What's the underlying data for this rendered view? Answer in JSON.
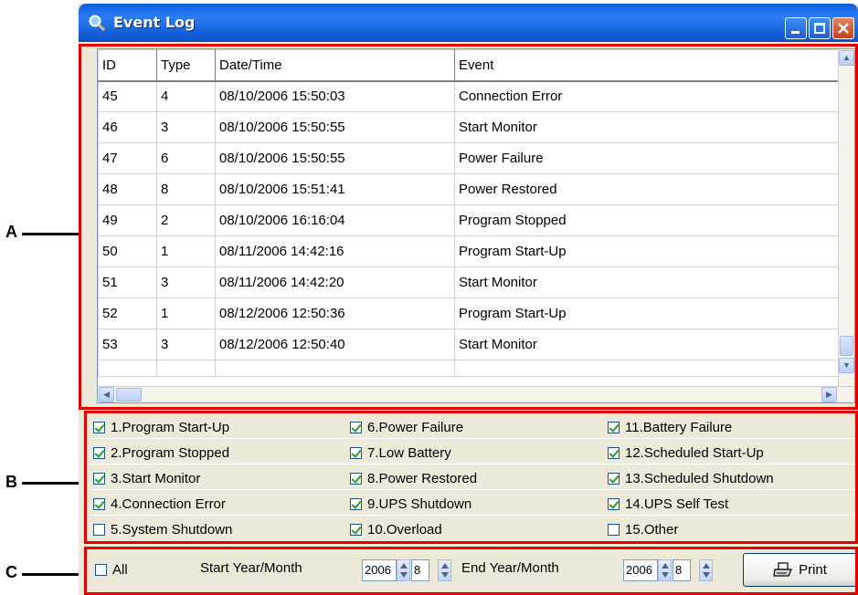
{
  "window": {
    "title": "Event Log"
  },
  "callouts": [
    "A",
    "B",
    "C"
  ],
  "table": {
    "columns": [
      "ID",
      "Type",
      "Date/Time",
      "Event"
    ],
    "rows": [
      [
        "45",
        "4",
        "08/10/2006 15:50:03",
        "Connection Error"
      ],
      [
        "46",
        "3",
        "08/10/2006 15:50:55",
        "Start Monitor"
      ],
      [
        "47",
        "6",
        "08/10/2006 15:50:55",
        "Power Failure"
      ],
      [
        "48",
        "8",
        "08/10/2006 15:51:41",
        "Power Restored"
      ],
      [
        "49",
        "2",
        "08/10/2006 16:16:04",
        "Program Stopped"
      ],
      [
        "50",
        "1",
        "08/11/2006 14:42:16",
        "Program Start-Up"
      ],
      [
        "51",
        "3",
        "08/11/2006 14:42:20",
        "Start Monitor"
      ],
      [
        "52",
        "1",
        "08/12/2006 12:50:36",
        "Program Start-Up"
      ],
      [
        "53",
        "3",
        "08/12/2006 12:50:40",
        "Start Monitor"
      ]
    ]
  },
  "filters": [
    {
      "label": "1.Program Start-Up",
      "checked": true
    },
    {
      "label": "2.Program Stopped",
      "checked": true
    },
    {
      "label": "3.Start Monitor",
      "checked": true
    },
    {
      "label": "4.Connection Error",
      "checked": true
    },
    {
      "label": "5.System Shutdown",
      "checked": false
    },
    {
      "label": "6.Power Failure",
      "checked": true
    },
    {
      "label": "7.Low Battery",
      "checked": true
    },
    {
      "label": "8.Power Restored",
      "checked": true
    },
    {
      "label": "9.UPS Shutdown",
      "checked": true
    },
    {
      "label": "10.Overload",
      "checked": true
    },
    {
      "label": "11.Battery Failure",
      "checked": true
    },
    {
      "label": "12.Scheduled Start-Up",
      "checked": true
    },
    {
      "label": "13.Scheduled Shutdown",
      "checked": true
    },
    {
      "label": "14.UPS Self Test",
      "checked": true
    },
    {
      "label": "15.Other",
      "checked": false
    }
  ],
  "bottom": {
    "all_label": "All",
    "all_checked": false,
    "start_label": "Start Year/Month",
    "start_year": "2006",
    "start_month": "8",
    "end_label": "End Year/Month",
    "end_year": "2006",
    "end_month": "8",
    "print_label": "Print"
  },
  "colors": {
    "titlebar": "#1b65de",
    "highlight": "#e00000",
    "window_bg": "#ece9d8"
  }
}
